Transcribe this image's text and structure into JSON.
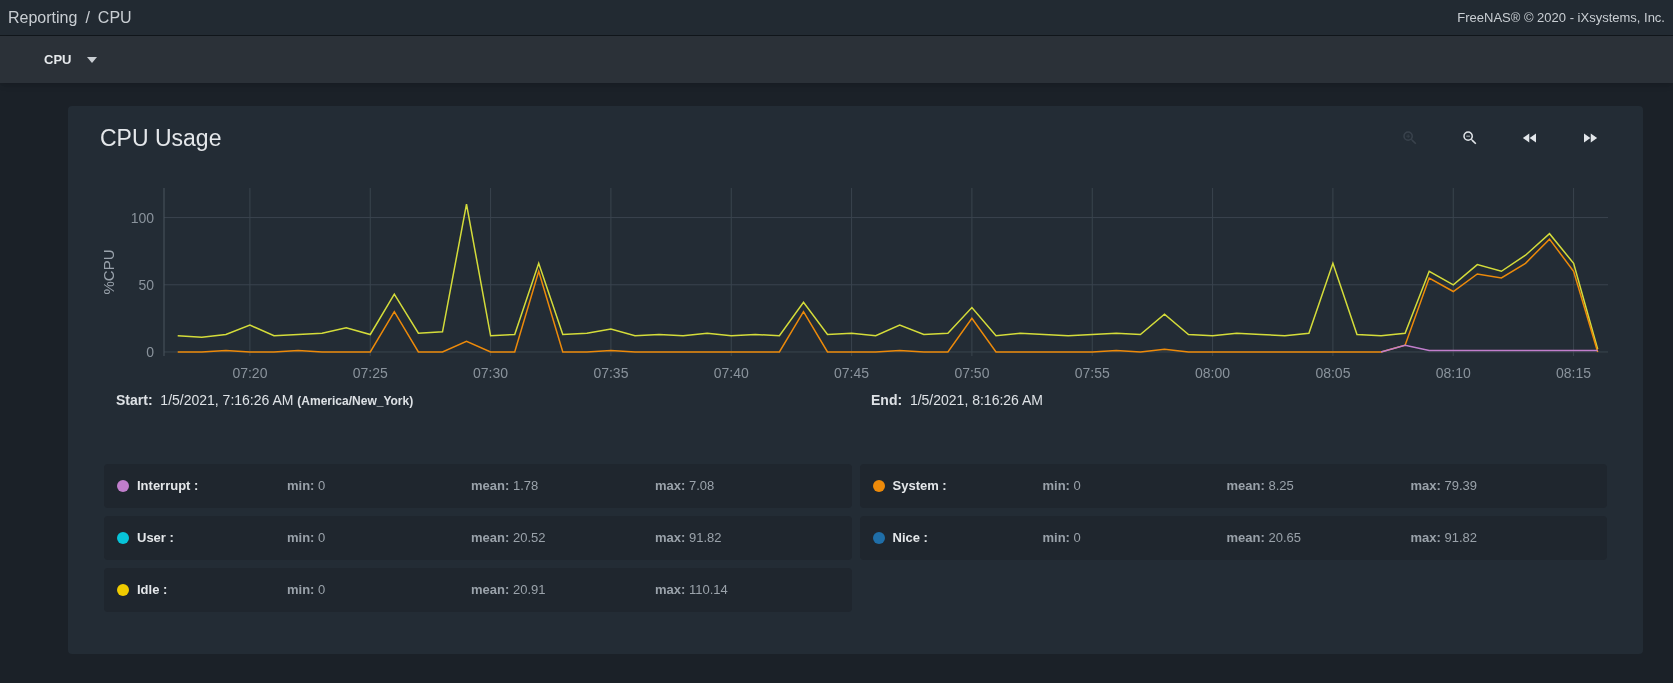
{
  "breadcrumb": [
    "Reporting",
    "CPU"
  ],
  "breadcrumb_separator": "/",
  "copyright": "FreeNAS® © 2020 - iXsystems, Inc.",
  "toolbar": {
    "dropdown": "CPU"
  },
  "card": {
    "title": "CPU Usage",
    "controls": [
      {
        "kind": "zoom-in",
        "disabled": true
      },
      {
        "kind": "zoom-out",
        "disabled": false
      },
      {
        "kind": "rewind",
        "disabled": false
      },
      {
        "kind": "forward",
        "disabled": false
      }
    ],
    "chart_data": {
      "type": "line",
      "ylabel": "%CPU",
      "categories": [
        null,
        null,
        null,
        "07:20",
        null,
        null,
        null,
        null,
        "07:25",
        null,
        null,
        null,
        null,
        "07:30",
        null,
        null,
        null,
        null,
        "07:35",
        null,
        null,
        null,
        null,
        "07:40",
        null,
        null,
        null,
        null,
        "07:45",
        null,
        null,
        null,
        null,
        "07:50",
        null,
        null,
        null,
        null,
        "07:55",
        null,
        null,
        null,
        null,
        "08:00",
        null,
        null,
        null,
        null,
        "08:05",
        null,
        null,
        null,
        null,
        "08:10",
        null,
        null,
        null,
        null,
        "08:15",
        null
      ],
      "series": [
        {
          "color": "#d4dc3a",
          "values": [
            12,
            11,
            13,
            20,
            12,
            13,
            14,
            18,
            13,
            43,
            14,
            15,
            110,
            12,
            13,
            66,
            13,
            14,
            17,
            12,
            13,
            12,
            14,
            12,
            13,
            12,
            37,
            13,
            14,
            12,
            20,
            13,
            14,
            33,
            12,
            14,
            13,
            12,
            13,
            14,
            13,
            28,
            13,
            12,
            14,
            13,
            12,
            14,
            66,
            13,
            12,
            14,
            60,
            50,
            65,
            60,
            72,
            88,
            66,
            2
          ]
        },
        {
          "color": "#ed8a0a",
          "values": [
            0,
            0,
            1,
            0,
            0,
            1,
            0,
            0,
            0,
            30,
            0,
            0,
            8,
            0,
            0,
            60,
            0,
            0,
            1,
            0,
            0,
            0,
            0,
            0,
            0,
            0,
            30,
            0,
            0,
            0,
            1,
            0,
            0,
            25,
            0,
            0,
            0,
            0,
            0,
            1,
            0,
            2,
            0,
            0,
            0,
            0,
            0,
            0,
            0,
            0,
            0,
            5,
            55,
            45,
            58,
            55,
            66,
            84,
            60,
            0
          ]
        },
        {
          "color": "#c17ecc",
          "values": [
            null,
            null,
            null,
            null,
            null,
            null,
            null,
            null,
            null,
            null,
            null,
            null,
            null,
            null,
            null,
            null,
            null,
            null,
            null,
            null,
            null,
            null,
            null,
            null,
            null,
            null,
            null,
            null,
            null,
            null,
            null,
            null,
            null,
            null,
            null,
            null,
            null,
            null,
            null,
            null,
            null,
            null,
            null,
            null,
            null,
            null,
            null,
            null,
            null,
            null,
            0,
            5,
            1,
            1,
            1,
            1,
            1,
            1,
            1,
            1
          ]
        }
      ],
      "grid": true,
      "ylim": [
        -3,
        122
      ],
      "yticks": [
        0,
        50,
        100
      ]
    },
    "start": {
      "label": "Start:",
      "value": "1/5/2021, 7:16:26 AM",
      "zone": "(America/New_York)"
    },
    "end": {
      "label": "End:",
      "value": "1/5/2021, 8:16:26 AM"
    },
    "legend": [
      {
        "name": "Interrupt :",
        "color": "#c17ecc",
        "stats": [
          {
            "label": "min:",
            "value": "0"
          },
          {
            "label": "mean:",
            "value": "1.78"
          },
          {
            "label": "max:",
            "value": "7.08"
          }
        ]
      },
      {
        "name": "System :",
        "color": "#ed8a0a",
        "stats": [
          {
            "label": "min:",
            "value": "0"
          },
          {
            "label": "mean:",
            "value": "8.25"
          },
          {
            "label": "max:",
            "value": "79.39"
          }
        ]
      },
      {
        "name": "User :",
        "color": "#07c4d9",
        "stats": [
          {
            "label": "min:",
            "value": "0"
          },
          {
            "label": "mean:",
            "value": "20.52"
          },
          {
            "label": "max:",
            "value": "91.82"
          }
        ]
      },
      {
        "name": "Nice :",
        "color": "#1f6ea8",
        "stats": [
          {
            "label": "min:",
            "value": "0"
          },
          {
            "label": "mean:",
            "value": "20.65"
          },
          {
            "label": "max:",
            "value": "91.82"
          }
        ]
      },
      {
        "name": "Idle :",
        "color": "#f0cb00",
        "stats": [
          {
            "label": "min:",
            "value": "0"
          },
          {
            "label": "mean:",
            "value": "20.91"
          },
          {
            "label": "max:",
            "value": "110.14"
          }
        ]
      }
    ]
  }
}
